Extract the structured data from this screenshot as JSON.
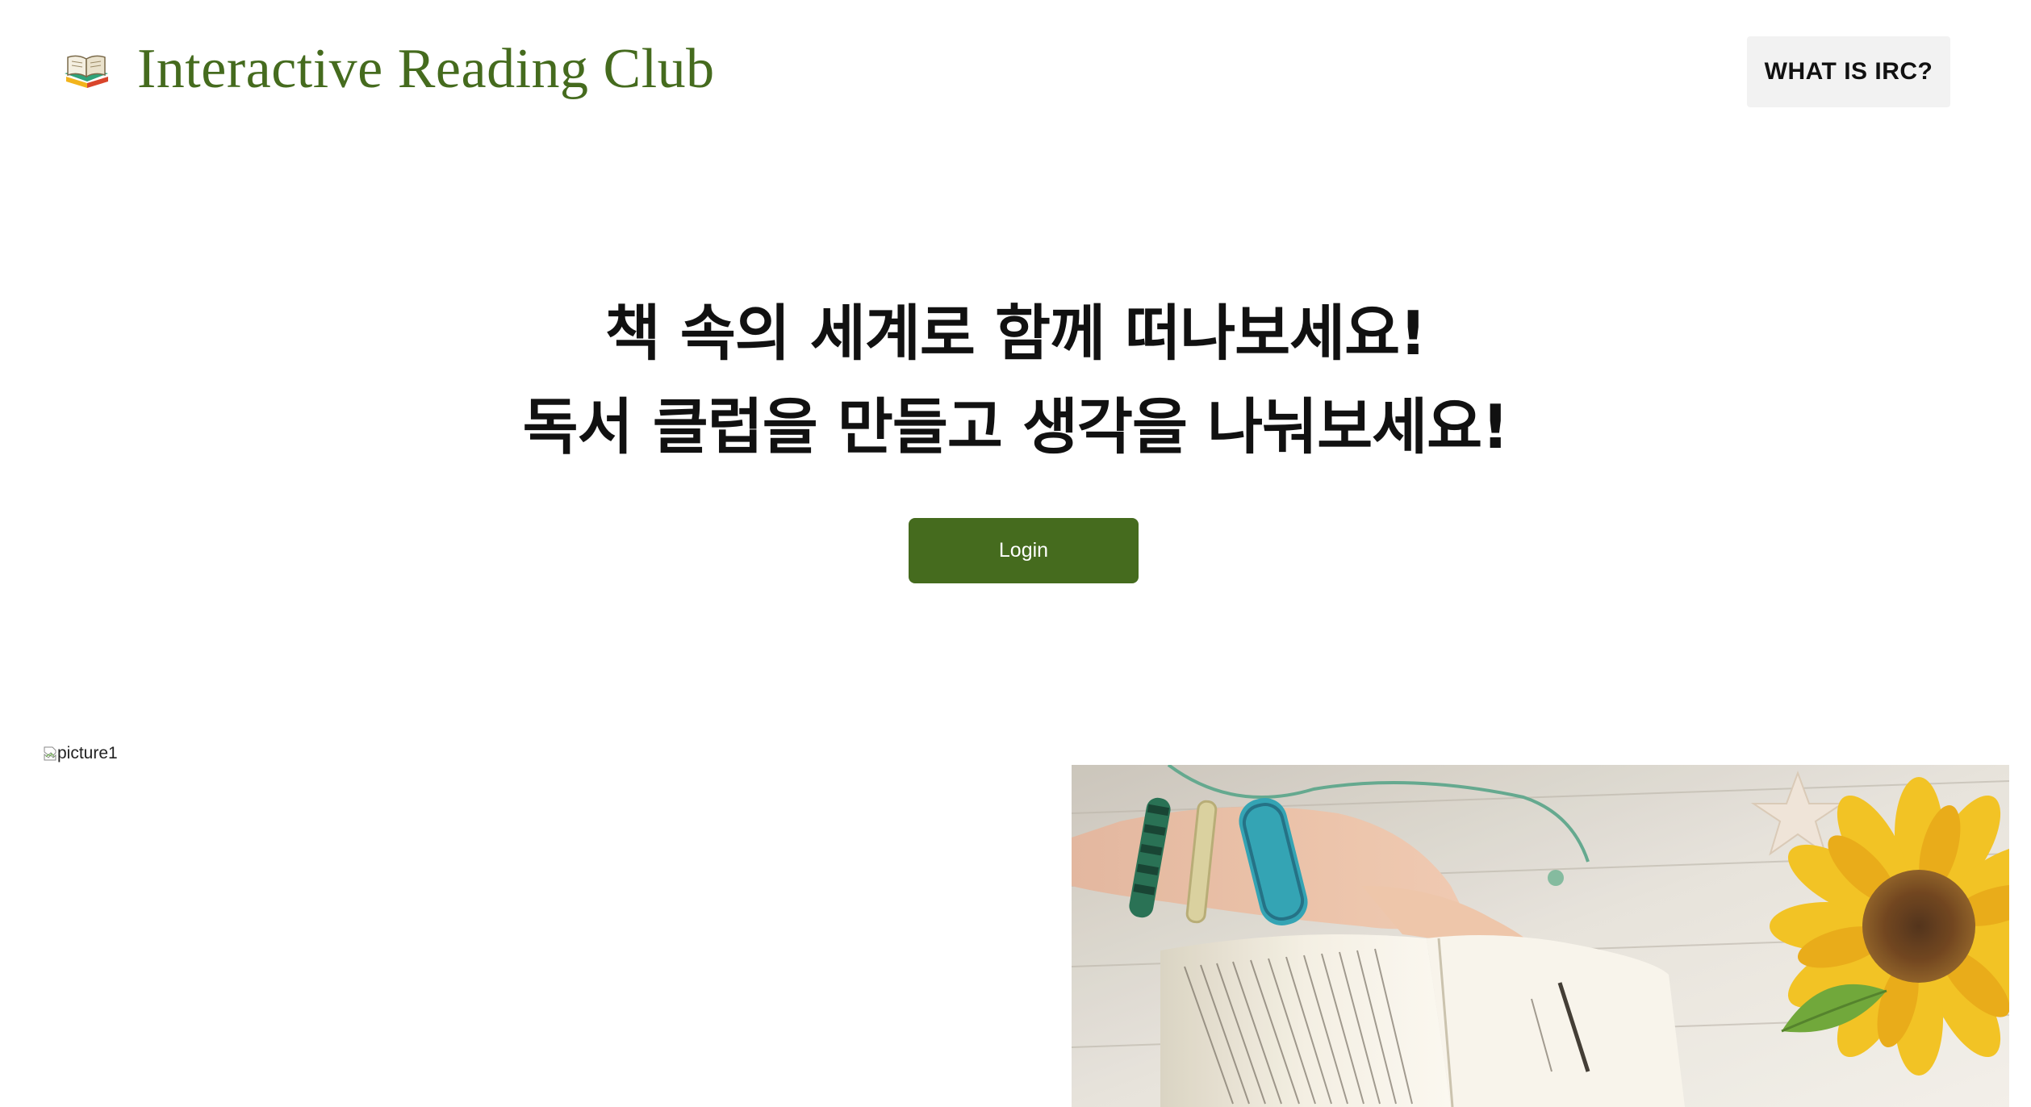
{
  "header": {
    "brand_title": "Interactive Reading Club",
    "logo_icon": "open-book-icon",
    "nav_button_label": "WHAT IS IRC?"
  },
  "hero": {
    "line1": "책 속의 세계로 함께 떠나보세요!",
    "line2": "독서 클럽을 만들고 생각을 나눠보세요!",
    "login_label": "Login"
  },
  "images": {
    "picture1_alt": "picture1",
    "broken_icon": "broken-image-icon",
    "photo_icon": "reading-book-sunflower-photo"
  },
  "colors": {
    "brand_green": "#456b1e",
    "nav_button_bg": "#f2f2f2",
    "text_dark": "#111111",
    "background": "#ffffff"
  }
}
